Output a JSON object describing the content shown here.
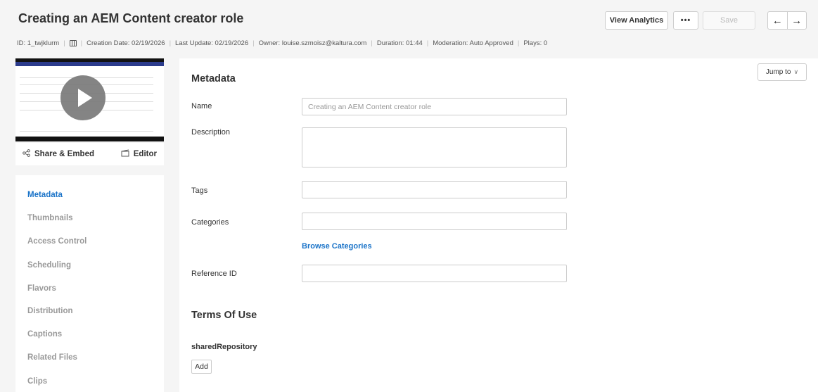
{
  "header": {
    "title": "Creating an AEM Content creator role",
    "view_analytics": "View Analytics",
    "more": "•••",
    "save": "Save",
    "prev": "←",
    "next": "→"
  },
  "meta_line": {
    "id": "ID: 1_twjklurm",
    "creation": "Creation Date: 02/19/2026",
    "update": "Last Update: 02/19/2026",
    "owner": "Owner: louise.szmoisz@kaltura.com",
    "duration": "Duration: 01:44",
    "moderation": "Moderation: Auto Approved",
    "plays": "Plays: 0"
  },
  "media_actions": {
    "share": "Share & Embed",
    "editor": "Editor"
  },
  "sidenav": {
    "items": [
      {
        "label": "Metadata",
        "active": true
      },
      {
        "label": "Thumbnails",
        "active": false
      },
      {
        "label": "Access Control",
        "active": false
      },
      {
        "label": "Scheduling",
        "active": false
      },
      {
        "label": "Flavors",
        "active": false
      },
      {
        "label": "Distribution",
        "active": false
      },
      {
        "label": "Captions",
        "active": false
      },
      {
        "label": "Related Files",
        "active": false
      },
      {
        "label": "Clips",
        "active": false
      }
    ]
  },
  "panel": {
    "jump_to": "Jump to",
    "metadata_heading": "Metadata",
    "name_label": "Name",
    "name_value": "Creating an AEM Content creator role",
    "description_label": "Description",
    "description_value": "",
    "tags_label": "Tags",
    "tags_value": "",
    "categories_label": "Categories",
    "categories_value": "",
    "browse_categories": "Browse Categories",
    "reference_label": "Reference ID",
    "reference_value": "",
    "terms_heading": "Terms Of Use",
    "shared_repository": "sharedRepository",
    "add_label": "Add"
  },
  "colors": {
    "accent": "#1a73c8",
    "background": "#f5f5f5"
  }
}
